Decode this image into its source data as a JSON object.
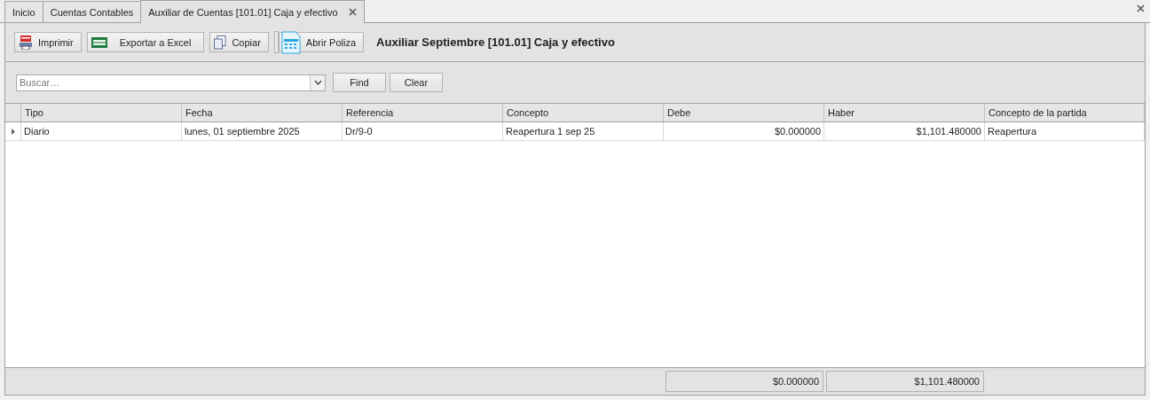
{
  "tabs": [
    {
      "label": "Inicio",
      "selected": false
    },
    {
      "label": "Cuentas Contables",
      "selected": false
    },
    {
      "label": "Auxiliar de Cuentas [101.01] Caja y efectivo",
      "selected": true
    }
  ],
  "toolbar": {
    "buttons": [
      {
        "label": "Imprimir",
        "kind": "pdf"
      },
      {
        "label": "Exportar a Excel",
        "kind": "excel"
      },
      {
        "label": "Copiar",
        "kind": "copy"
      },
      {
        "label": "Abrir Poliza",
        "kind": "document"
      }
    ],
    "title": "Auxiliar Septiembre [101.01] Caja y efectivo"
  },
  "search": {
    "placeholder": "Buscar…",
    "buttons": [
      "Find",
      "Clear"
    ]
  },
  "table": {
    "columns": [
      {
        "label": "Tipo",
        "kind": "text"
      },
      {
        "label": "Fecha",
        "kind": "text"
      },
      {
        "label": "Referencia",
        "kind": "text"
      },
      {
        "label": "Concepto",
        "kind": "text"
      },
      {
        "label": "Debe",
        "kind": "money",
        "total": "$0.000000"
      },
      {
        "label": "Haber",
        "kind": "money",
        "total": "$1,101.480000"
      },
      {
        "label": "Concepto de la partida",
        "kind": "text"
      }
    ],
    "rows": [
      {
        "current": true,
        "cells": [
          "Diario",
          "lunes, 01 septiembre 2025",
          "Dr/9-0",
          "Reapertura 1 sep 25",
          "$0.000000",
          "$1,101.480000",
          "Reapertura"
        ]
      }
    ]
  }
}
